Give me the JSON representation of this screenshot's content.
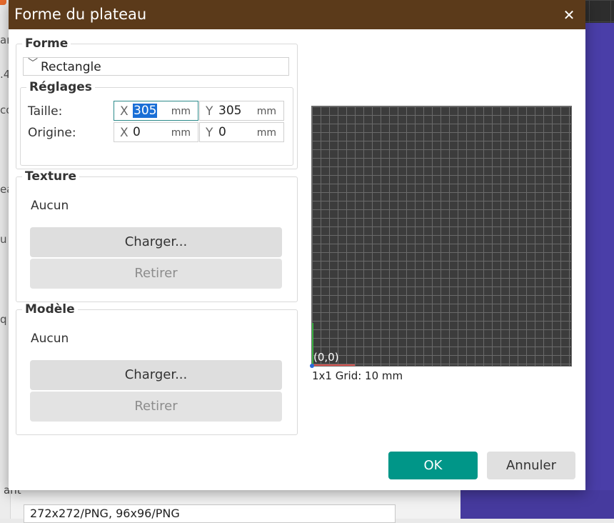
{
  "background": {
    "left_fragments": [
      "ar",
      ".4",
      "co",
      "ea",
      "u",
      "q"
    ],
    "bottom_label": "ant",
    "bottom_field": "272x272/PNG, 96x96/PNG"
  },
  "dialog": {
    "title": "Forme du plateau",
    "close_icon": "close-icon",
    "shape_group": {
      "title": "Forme",
      "selected_shape": "Rectangle",
      "settings": {
        "title": "Réglages",
        "size_label": "Taille:",
        "origin_label": "Origine:",
        "size_x": "305",
        "size_y": "305",
        "origin_x": "0",
        "origin_y": "0",
        "axis_x": "X",
        "axis_y": "Y",
        "unit": "mm"
      }
    },
    "texture_group": {
      "title": "Texture",
      "current": "Aucun",
      "load_label": "Charger...",
      "remove_label": "Retirer"
    },
    "model_group": {
      "title": "Modèle",
      "current": "Aucun",
      "load_label": "Charger...",
      "remove_label": "Retirer"
    },
    "preview": {
      "origin_label": "(0,0)",
      "grid_caption": "1x1 Grid: 10 mm",
      "x_axis_color": "#d9534f",
      "y_axis_color": "#3cb043"
    },
    "ok_label": "OK",
    "cancel_label": "Annuler"
  },
  "colors": {
    "titlebar": "#5b3a1a",
    "ok_button": "#009688",
    "focus_border": "#2d8b8b",
    "selection": "#1a6fd6"
  }
}
